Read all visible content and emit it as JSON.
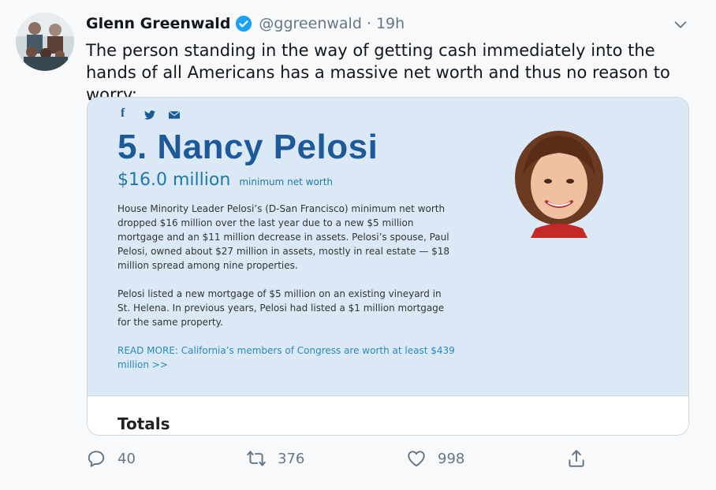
{
  "tweet": {
    "author_name": "Glenn Greenwald",
    "handle": "@ggreenwald",
    "separator": "·",
    "time": "19h",
    "text": "The person standing in the way of getting cash immediately into the hands of all Americans has a massive net worth and thus no reason to worry:"
  },
  "card": {
    "share_icons": [
      "facebook-icon",
      "twitter-icon",
      "mail-icon"
    ],
    "share_labels": {
      "facebook": "f"
    },
    "title": "5. Nancy Pelosi",
    "net_worth_amount": "$16.0 million",
    "net_worth_label": "minimum net worth",
    "paragraph1": "House Minority Leader Pelosi’s (D-San Francisco) minimum net worth dropped $16 million over the last year due to a new $5 million mortgage and an $11 million decrease in assets. Pelosi’s spouse, Paul Pelosi, owned about $27 million in assets, mostly in real estate — $18 million spread among nine properties.",
    "paragraph2": "Pelosi listed a new mortgage of $5 million on an existing vineyard in St. Helena. In previous years, Pelosi had listed a $1 million mortgage for the same property.",
    "read_more": "READ MORE: California’s members of Congress are worth at least $439 million >>",
    "totals_heading": "Totals"
  },
  "actions": {
    "reply_count": "40",
    "retweet_count": "376",
    "like_count": "998"
  },
  "colors": {
    "verified": "#1da1f2",
    "card_background": "#dbe9f7",
    "title": "#1f5a98",
    "link": "#2a8ab8",
    "muted": "#657786"
  }
}
